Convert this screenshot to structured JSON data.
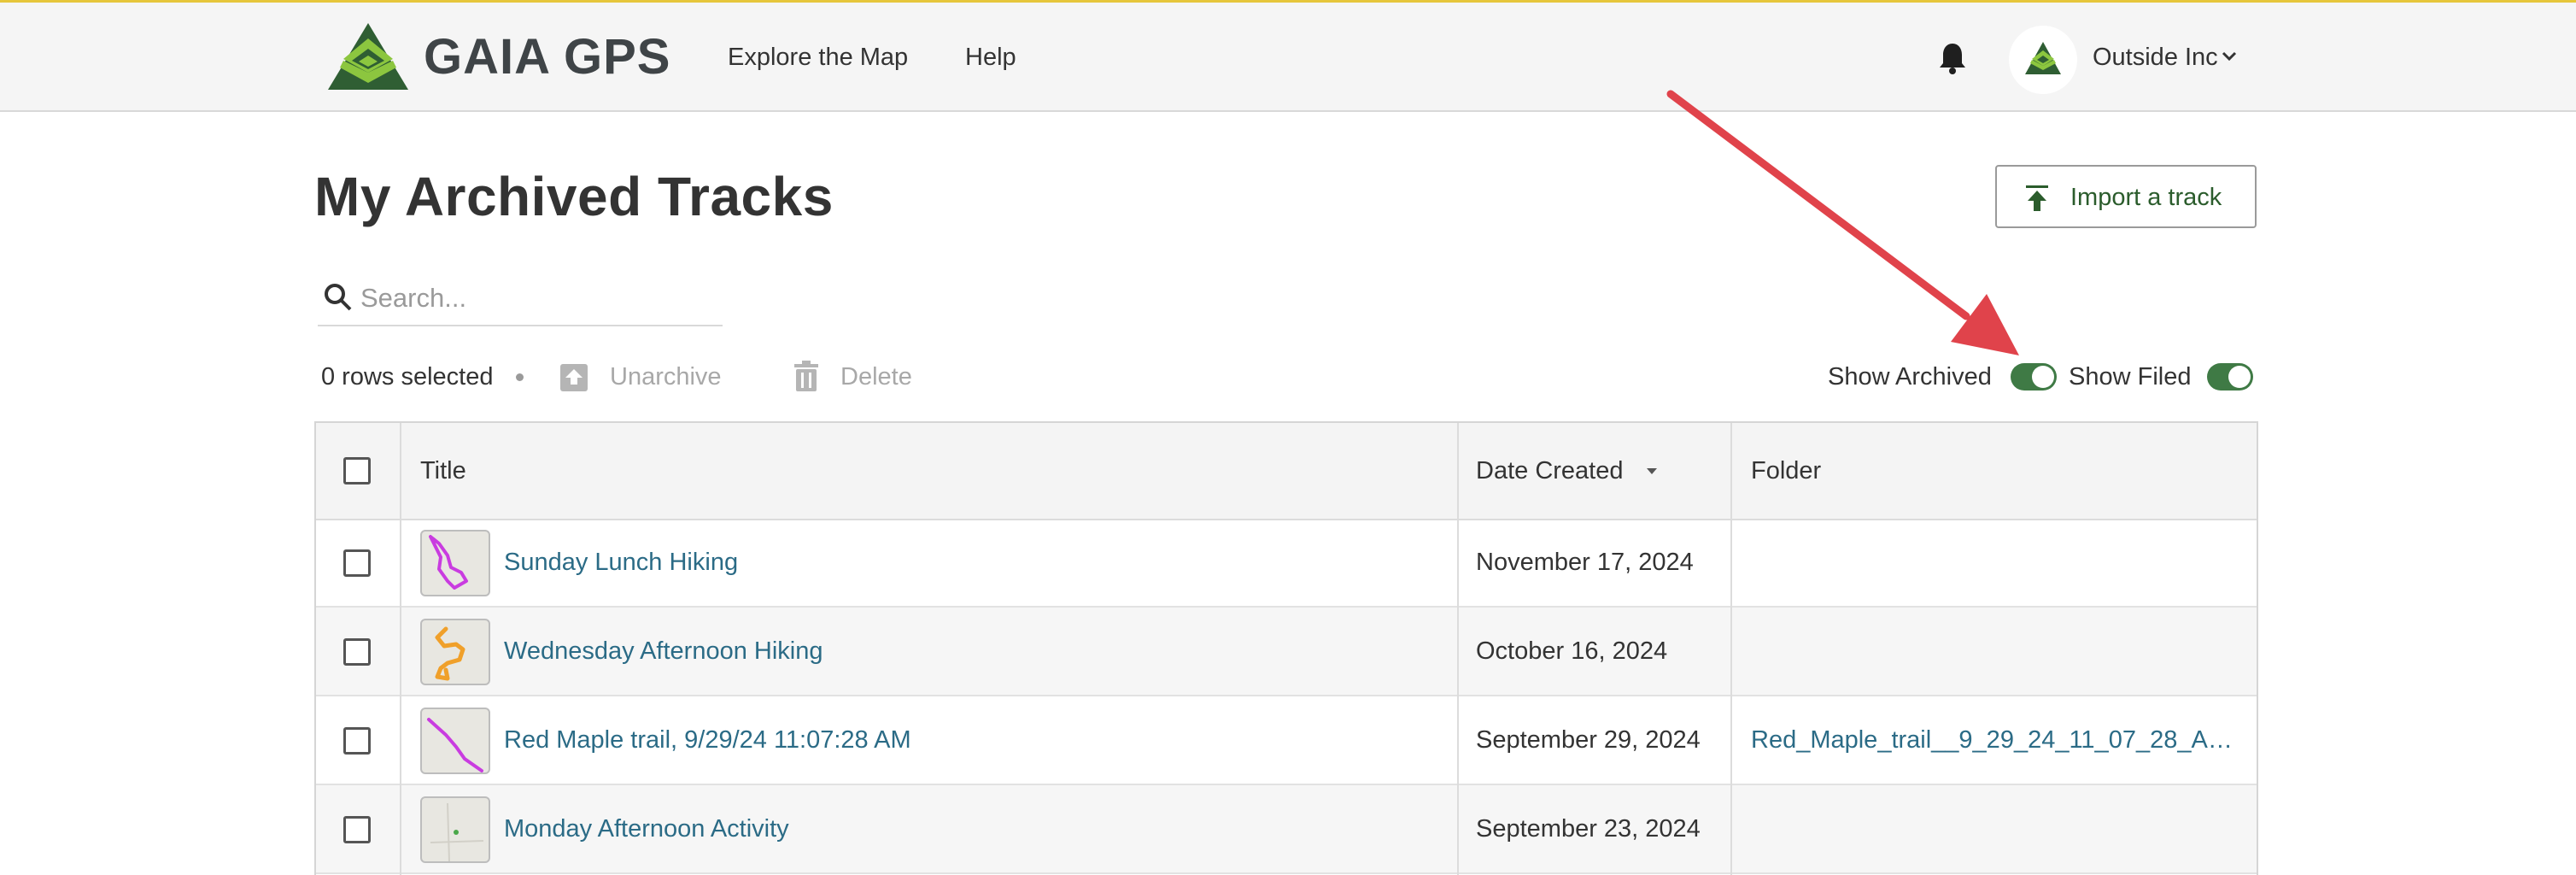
{
  "header": {
    "brand": "GAIA GPS",
    "nav": [
      {
        "label": "Explore the Map"
      },
      {
        "label": "Help"
      }
    ],
    "user": {
      "name": "Outside Inc"
    }
  },
  "page": {
    "title": "My Archived Tracks",
    "import_label": "Import a track"
  },
  "search": {
    "placeholder": "Search..."
  },
  "toolbar": {
    "rows_selected": "0 rows selected",
    "unarchive_label": "Unarchive",
    "delete_label": "Delete",
    "show_archived_label": "Show Archived",
    "show_archived_on": true,
    "show_filed_label": "Show Filed",
    "show_filed_on": true
  },
  "table": {
    "columns": {
      "title": "Title",
      "date": "Date Created",
      "folder": "Folder"
    },
    "sort": {
      "column": "Date Created",
      "direction": "descending"
    },
    "rows": [
      {
        "title": "Sunday Lunch Hiking",
        "date": "November 17, 2024",
        "folder": "",
        "track_color": "#c93ce0"
      },
      {
        "title": "Wednesday Afternoon Hiking",
        "date": "October 16, 2024",
        "folder": "",
        "track_color": "#f0a02a"
      },
      {
        "title": "Red Maple trail, 9/29/24 11:07:28 AM",
        "date": "September 29, 2024",
        "folder": "Red_Maple_trail__9_29_24_11_07_28_AM_g...",
        "track_color": "#c93ce0"
      },
      {
        "title": "Monday Afternoon Activity",
        "date": "September 23, 2024",
        "folder": "",
        "track_color": "#4aa84a"
      }
    ]
  },
  "colors": {
    "accent_green": "#3f7a45",
    "link_blue": "#2b6b86",
    "annotation_arrow": "#e0434b",
    "top_border": "#e6c63b"
  }
}
